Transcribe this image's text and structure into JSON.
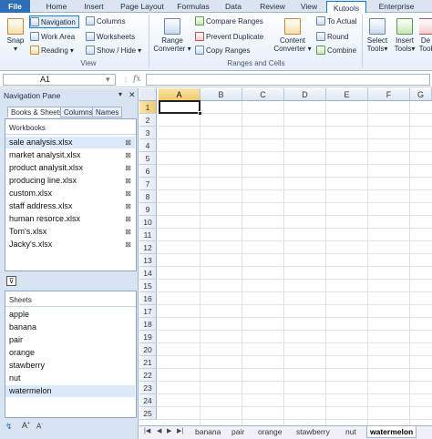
{
  "ribbon_tabs": [
    "File",
    "Home",
    "Insert",
    "Page Layout",
    "Formulas",
    "Data",
    "Review",
    "View",
    "Kutools",
    "Enterprise"
  ],
  "active_tab": "Kutools",
  "ribbon": {
    "snap": "Snap",
    "navigation": "Navigation",
    "work_area": "Work Area",
    "reading": "Reading",
    "columns": "Columns",
    "worksheets": "Worksheets",
    "show_hide": "Show / Hide",
    "view_group": "View",
    "range_converter_1": "Range",
    "range_converter_2": "Converter",
    "compare_ranges": "Compare Ranges",
    "prevent_duplicate": "Prevent Duplicate",
    "copy_ranges": "Copy Ranges",
    "content_converter_1": "Content",
    "content_converter_2": "Converter",
    "to_actual": "To Actual",
    "round": "Round",
    "combine": "Combine",
    "ranges_group": "Ranges and Cells",
    "select_tools_1": "Select",
    "select_tools_2": "Tools",
    "insert_tools_1": "Insert",
    "insert_tools_2": "Tools",
    "delete_1": "De",
    "delete_2": "Tool"
  },
  "formula_bar": {
    "name_box": "A1",
    "fx": "fx"
  },
  "pane": {
    "title": "Navigation Pane",
    "tabs": [
      "Books & Sheets",
      "Columns",
      "Names"
    ],
    "workbooks_label": "Workbooks",
    "workbooks": [
      "sale analysis.xlsx",
      "market analysit.xlsx",
      "product analysit.xlsx",
      "producing line.xlsx",
      "custom.xlsx",
      "staff address.xlsx",
      "human resorce.xlsx",
      "Tom's.xlsx",
      "Jacky's.xlsx"
    ],
    "sheets_label": "Sheets",
    "sheets": [
      "apple",
      "banana",
      "pair",
      "orange",
      "stawberry",
      "nut",
      "watermelon"
    ]
  },
  "grid": {
    "columns": [
      "A",
      "B",
      "C",
      "D",
      "E",
      "F",
      "G"
    ],
    "rows": [
      "1",
      "2",
      "3",
      "4",
      "5",
      "6",
      "7",
      "8",
      "9",
      "10",
      "11",
      "12",
      "13",
      "14",
      "15",
      "16",
      "17",
      "18",
      "19",
      "20",
      "21",
      "22",
      "23",
      "24",
      "25"
    ]
  },
  "sheet_tabs": [
    "banana",
    "pair",
    "orange",
    "stawberry",
    "nut",
    "watermelon"
  ],
  "active_sheet": "watermelon"
}
